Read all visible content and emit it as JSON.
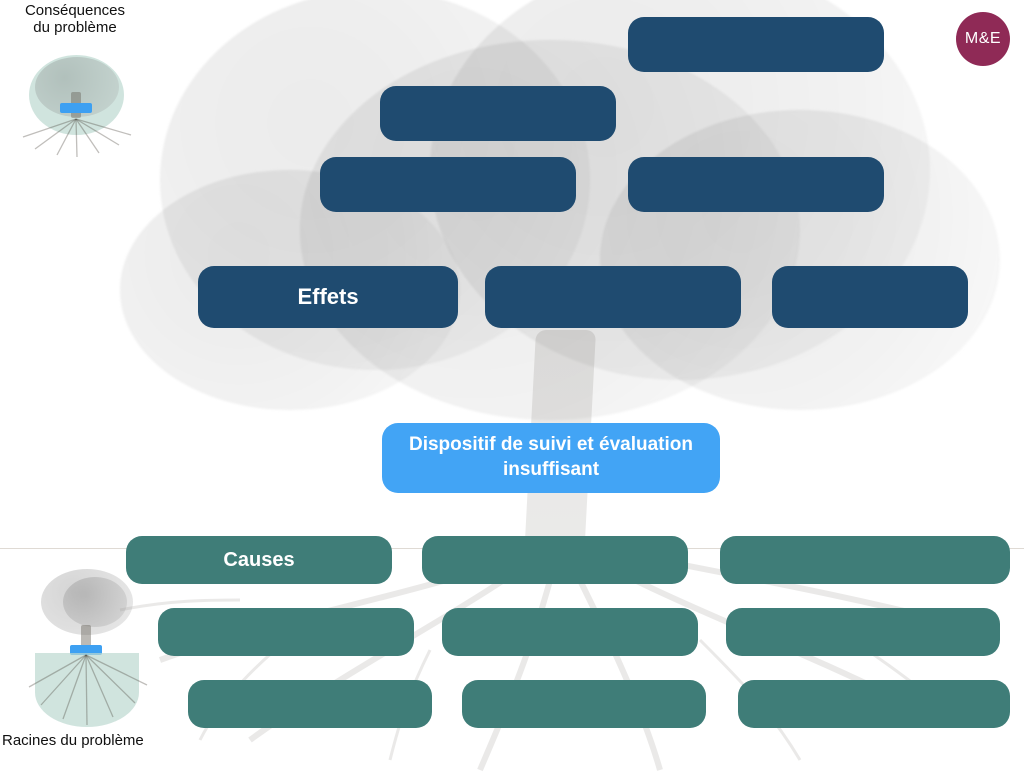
{
  "badge": {
    "label": "M&E"
  },
  "legend": {
    "top": {
      "line1": "Conséquences",
      "line2": "du problème"
    },
    "bottom": {
      "label": "Racines du problème"
    }
  },
  "center": {
    "label": "Dispositif de suivi et évaluation insuffisant"
  },
  "effects": {
    "title": "Effets",
    "boxes": {
      "r0_a": "",
      "r1_a": "",
      "r2_a": "",
      "r2_b": "",
      "r3_b": "",
      "r3_c": ""
    }
  },
  "causes": {
    "title": "Causes",
    "boxes": {
      "r0_b": "",
      "r0_c": "",
      "r1_a": "",
      "r1_b": "",
      "r1_c": "",
      "r2_a": "",
      "r2_b": "",
      "r2_c": ""
    }
  },
  "colors": {
    "navy": "#1f4b70",
    "teal": "#3f7d78",
    "accent": "#42a4f5",
    "badge": "#8f2a56"
  },
  "chart_data": {
    "type": "diagram",
    "subtype": "problem-tree",
    "central_problem": "Dispositif de suivi et évaluation insuffisant",
    "effects_section_label": "Effets",
    "causes_section_label": "Causes",
    "effects_placeholders": 6,
    "causes_placeholders": 8,
    "legend_top": "Conséquences du problème",
    "legend_bottom": "Racines du problème",
    "badge": "M&E"
  }
}
